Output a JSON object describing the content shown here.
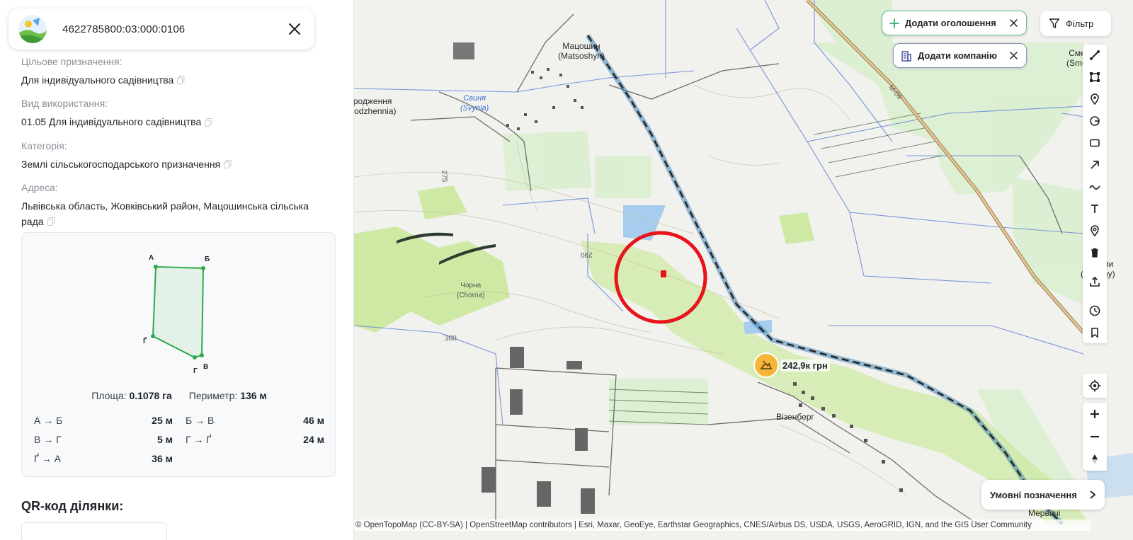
{
  "parcel": {
    "cadastral_number": "4622785800:03:000:0106"
  },
  "info": {
    "purpose_label": "Цільове призначення:",
    "purpose_value": "Для індивідуального садівництва",
    "usage_label": "Вид використання:",
    "usage_value": "01.05 Для індивідуального садівництва",
    "category_label": "Категорія:",
    "category_value": "Землі сільськогосподарського призначення",
    "address_label": "Адреса:",
    "address_value": "Львівська область, Жовківський район, Мацошинська сільська рада"
  },
  "shape": {
    "vertex_a": "А",
    "vertex_b": "Б",
    "vertex_v": "В",
    "vertex_g": "Г",
    "vertex_gg": "Ґ",
    "area_label": "Площа:",
    "area_value": "0.1078 га",
    "perimeter_label": "Периметр:",
    "perimeter_value": "136 м",
    "segments": [
      {
        "name": "А → Б",
        "length": "25 м"
      },
      {
        "name": "Б → В",
        "length": "46 м"
      },
      {
        "name": "В → Г",
        "length": "5 м"
      },
      {
        "name": "Г → Ґ",
        "length": "24 м"
      },
      {
        "name": "Ґ → А",
        "length": "36 м"
      }
    ]
  },
  "qr": {
    "title": "QR-код ділянки:"
  },
  "map": {
    "add_listing_label": "Додати оголошення",
    "add_company_label": "Додати компанію",
    "filter_label": "Фільтр",
    "legend_label": "Умовні позначення",
    "price_label": "242,9к грн",
    "attribution": "© OpenTopoMap (CC-BY-SA) | OpenStreetMap contributors | Esri, Maxar, GeoEye, Earthstar Geographics, CNES/Airbus DS, USDA, USGS, AeroGRID, IGN, and the GIS User Community",
    "labels": {
      "matsoshyn": "Мацошин",
      "matsoshyn_lat": "(Matsoshyn)",
      "vidrodzhennia": "Відродження",
      "vidrodzhennia_lat": "(Vidrodzhennia)",
      "svynia": "Свиня",
      "svynia_lat": "(Svynia)",
      "chorna": "Чорна",
      "chorna_lat": "(Chorna)",
      "vizenberh": "Візенберг",
      "smereky": "Смереки",
      "smereky_lat": "(Smerekv)",
      "feremy": "Фереми",
      "feremy_lat": "(Feremy)",
      "mervychi": "Мервичі",
      "road_m09": "М-09",
      "elev_300": "300",
      "elev_290": "290",
      "elev_275": "275"
    }
  },
  "colors": {
    "parcel_outline": "#2eaa4a",
    "parcel_fill": "#e3f1e8",
    "highlight_circle": "#e8141b",
    "add_listing_border": "#5fbf8e",
    "price_badge": "#f5b53a"
  }
}
